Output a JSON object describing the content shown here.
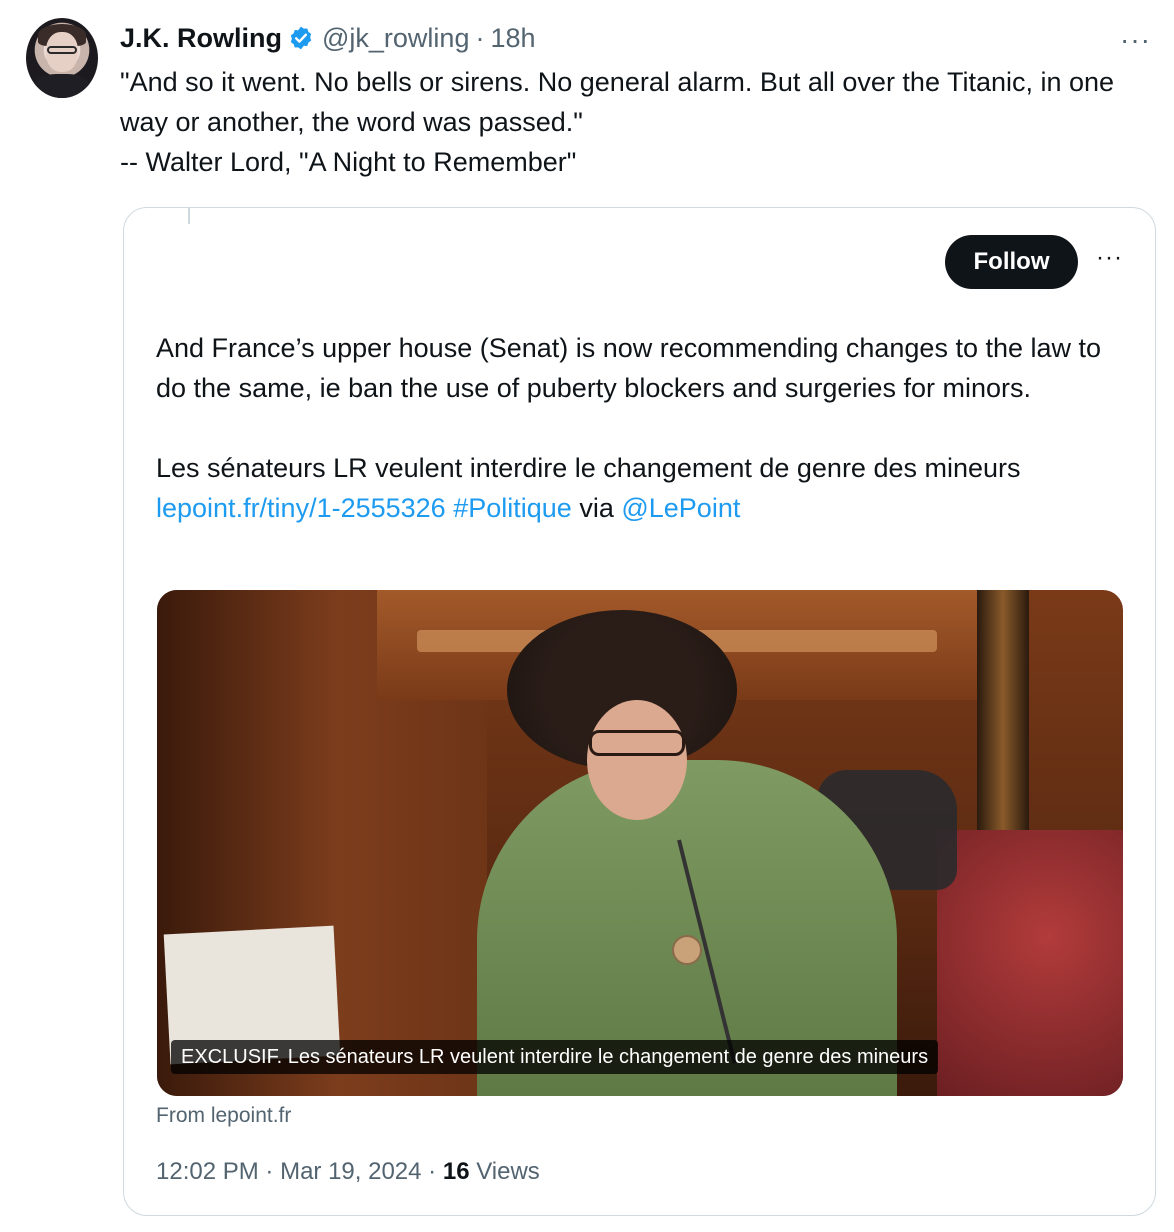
{
  "tweet": {
    "author_name": "J.K. Rowling",
    "author_handle": "@jk_rowling",
    "separator": "·",
    "time_ago": "18h",
    "more_label": "···",
    "text": "\"And so it went. No bells or sirens. No general alarm. But all over the Titanic, in one way or another, the word was passed.\"\n-- Walter Lord, \"A Night to Remember\""
  },
  "quote": {
    "follow_label": "Follow",
    "more_label": "···",
    "paragraph1": "And France’s upper house (Senat) is now recommending changes to the law to do the same, ie ban the use of puberty blockers and surgeries for minors.",
    "paragraph2_text": "Les sénateurs LR veulent interdire le changement de genre des mineurs",
    "link_url": "lepoint.fr/tiny/1-2555326",
    "hashtag": "#Politique",
    "via_label": "via",
    "mention": "@LePoint",
    "media_caption": "EXCLUSIF. Les sénateurs LR veulent interdire le changement de genre des mineurs",
    "source_label": "From lepoint.fr",
    "time": "12:02 PM",
    "date": "Mar 19, 2024",
    "separator": "·",
    "views_count": "16",
    "views_label": "Views"
  },
  "colors": {
    "link": "#1d9bf0",
    "verified": "#1d9bf0",
    "secondary_text": "#536471",
    "follow_bg": "#0f1419"
  }
}
